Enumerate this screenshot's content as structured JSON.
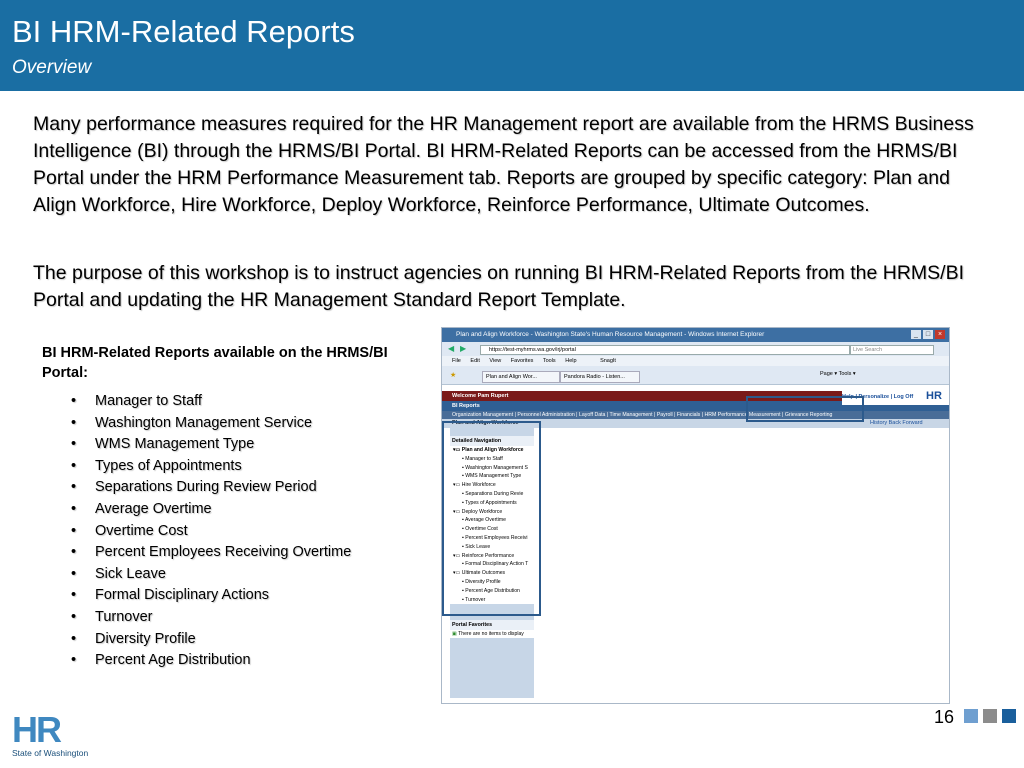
{
  "header": {
    "title": "BI HRM-Related Reports",
    "subtitle": "Overview"
  },
  "paragraphs": [
    "Many performance measures required for the HR Management report are available from the HRMS Business Intelligence (BI) through the HRMS/BI Portal.  BI HRM-Related Reports can be accessed from the HRMS/BI Portal under the HRM Performance Measurement tab.  Reports are grouped by specific category:  Plan and Align Workforce, Hire Workforce, Deploy Workforce, Reinforce Performance, Ultimate Outcomes.",
    "The purpose of this workshop is to instruct agencies on running BI HRM-Related Reports from the HRMS/BI Portal and updating the HR Management Standard Report Template."
  ],
  "report_list": {
    "title": "BI HRM-Related Reports available on the HRMS/BI Portal:",
    "items": [
      "Manager to Staff",
      "Washington Management Service",
      "WMS Management Type",
      "Types of Appointments",
      "Separations During Review Period",
      "Average Overtime",
      "Overtime Cost",
      "Percent Employees Receiving Overtime",
      "Sick Leave",
      "Formal Disciplinary Actions",
      "Turnover",
      "Diversity Profile",
      "Percent Age Distribution"
    ]
  },
  "browser": {
    "window_title": "Plan and Align Workforce - Washington State's Human Resource Management - Windows Internet Explorer",
    "url": "https://test-myhrms.wa.gov/irj/portal",
    "search_placeholder": "Live Search",
    "menu": [
      "File",
      "Edit",
      "View",
      "Favorites",
      "Tools",
      "Help"
    ],
    "snagit": "SnagIt",
    "tabs": [
      "Plan and Align Wor...",
      "Pandora Radio - Listen..."
    ],
    "toolbar_right": "Page ▾  Tools ▾",
    "welcome": "Welcome Pam Rupert",
    "top_links": "Help | Personalize | Log Off",
    "logo": "HR",
    "bi_reports": "BI Reports",
    "nav": "Organization Management  |  Personnel Administration  |  Layoff Data  |  Time Management  |  Payroll  |  Financials  |  HRM Performance Measurement  |  Grievance Reporting",
    "page_title": "Plan and Align Workforce",
    "history": "History  Back  Forward",
    "detailed_nav": "Detailed Navigation",
    "tree": [
      {
        "label": "Plan and Align Workforce",
        "level": 1
      },
      {
        "label": "Manager to Staff",
        "level": 2
      },
      {
        "label": "Washington Management S",
        "level": 2
      },
      {
        "label": "WMS Management Type",
        "level": 2
      },
      {
        "label": "Hire Workforce",
        "level": 1
      },
      {
        "label": "Separations During Revie",
        "level": 2
      },
      {
        "label": "Types of Appointments",
        "level": 2
      },
      {
        "label": "Deploy Workforce",
        "level": 1
      },
      {
        "label": "Average Overtime",
        "level": 2
      },
      {
        "label": "Overtime  Cost",
        "level": 2
      },
      {
        "label": "Percent Employees Receivi",
        "level": 2
      },
      {
        "label": "Sick Leave",
        "level": 2
      },
      {
        "label": "Reinforce Performance",
        "level": 1
      },
      {
        "label": "Formal Disciplinary Action T",
        "level": 2
      },
      {
        "label": "Ultimate Outcomes",
        "level": 1
      },
      {
        "label": "Diversity Profile",
        "level": 2
      },
      {
        "label": "Percent Age Distribution",
        "level": 2
      },
      {
        "label": "Turnover",
        "level": 2
      }
    ],
    "portal_favorites": "Portal Favorites",
    "favorites_empty": "There are no items to display"
  },
  "footer": {
    "page_number": "16",
    "logo_text": "HR",
    "logo_sub": "State of Washington",
    "square_colors": [
      "#6f9fd0",
      "#8c8c8c",
      "#1a5f9c"
    ]
  }
}
